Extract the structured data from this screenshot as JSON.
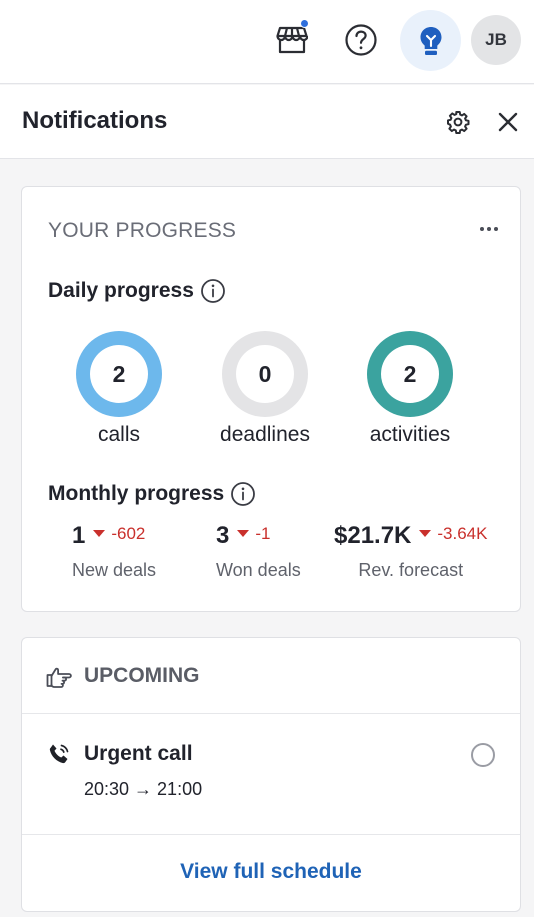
{
  "topbar": {
    "icons": [
      "marketplace-icon",
      "help-icon",
      "lightbulb-icon"
    ],
    "avatar_initials": "JB",
    "accent_color": "#2f6fdc"
  },
  "panel": {
    "title": "Notifications"
  },
  "progress": {
    "section_label": "YOUR PROGRESS",
    "daily_title": "Daily progress",
    "daily": [
      {
        "value": "2",
        "label": "calls",
        "color": "#6db8ec"
      },
      {
        "value": "0",
        "label": "deadlines",
        "color": "#e4e4e6"
      },
      {
        "value": "2",
        "label": "activities",
        "color": "#3ba39f"
      }
    ],
    "monthly_title": "Monthly progress",
    "monthly": [
      {
        "value": "1",
        "delta": "-602",
        "label": "New deals"
      },
      {
        "value": "3",
        "delta": "-1",
        "label": "Won deals"
      },
      {
        "value": "$21.7K",
        "delta": "-3.64K",
        "label": "Rev. forecast"
      }
    ]
  },
  "upcoming": {
    "section_label": "UPCOMING",
    "events": [
      {
        "title": "Urgent call",
        "time": "20:30 → 21:00"
      }
    ],
    "view_link": "View full schedule"
  }
}
